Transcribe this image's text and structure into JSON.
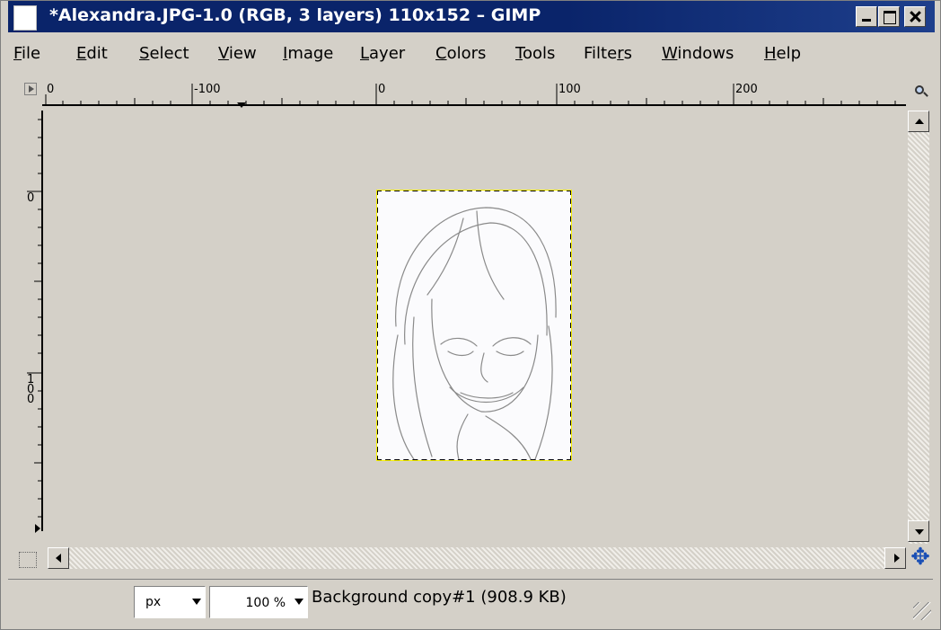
{
  "window": {
    "title": "*Alexandra.JPG-1.0 (RGB, 3 layers) 110x152 – GIMP",
    "colors": {
      "titlebar": "#0a246a",
      "chrome": "#d4d0c8",
      "selection_dash": "#f7f000"
    }
  },
  "menu": {
    "items": [
      {
        "label": "File",
        "mnemonic": "F"
      },
      {
        "label": "Edit",
        "mnemonic": "E"
      },
      {
        "label": "Select",
        "mnemonic": "S"
      },
      {
        "label": "View",
        "mnemonic": "V"
      },
      {
        "label": "Image",
        "mnemonic": "I"
      },
      {
        "label": "Layer",
        "mnemonic": "L"
      },
      {
        "label": "Colors",
        "mnemonic": "C"
      },
      {
        "label": "Tools",
        "mnemonic": "T"
      },
      {
        "label": "Filters",
        "mnemonic": "r"
      },
      {
        "label": "Windows",
        "mnemonic": "W"
      },
      {
        "label": "Help",
        "mnemonic": "H"
      }
    ]
  },
  "ruler": {
    "h_labels": [
      "0",
      "-100",
      "0",
      "100",
      "200"
    ],
    "v_labels": [
      "0",
      "100"
    ]
  },
  "statusbar": {
    "unit": "px",
    "zoom": "100 %",
    "message": "Background copy#1 (908.9 KB)"
  },
  "icons": [
    "quick-mask-icon",
    "zoom-to-fit-icon",
    "navigate-icon",
    "resize-grip-icon",
    "menu-icon"
  ]
}
